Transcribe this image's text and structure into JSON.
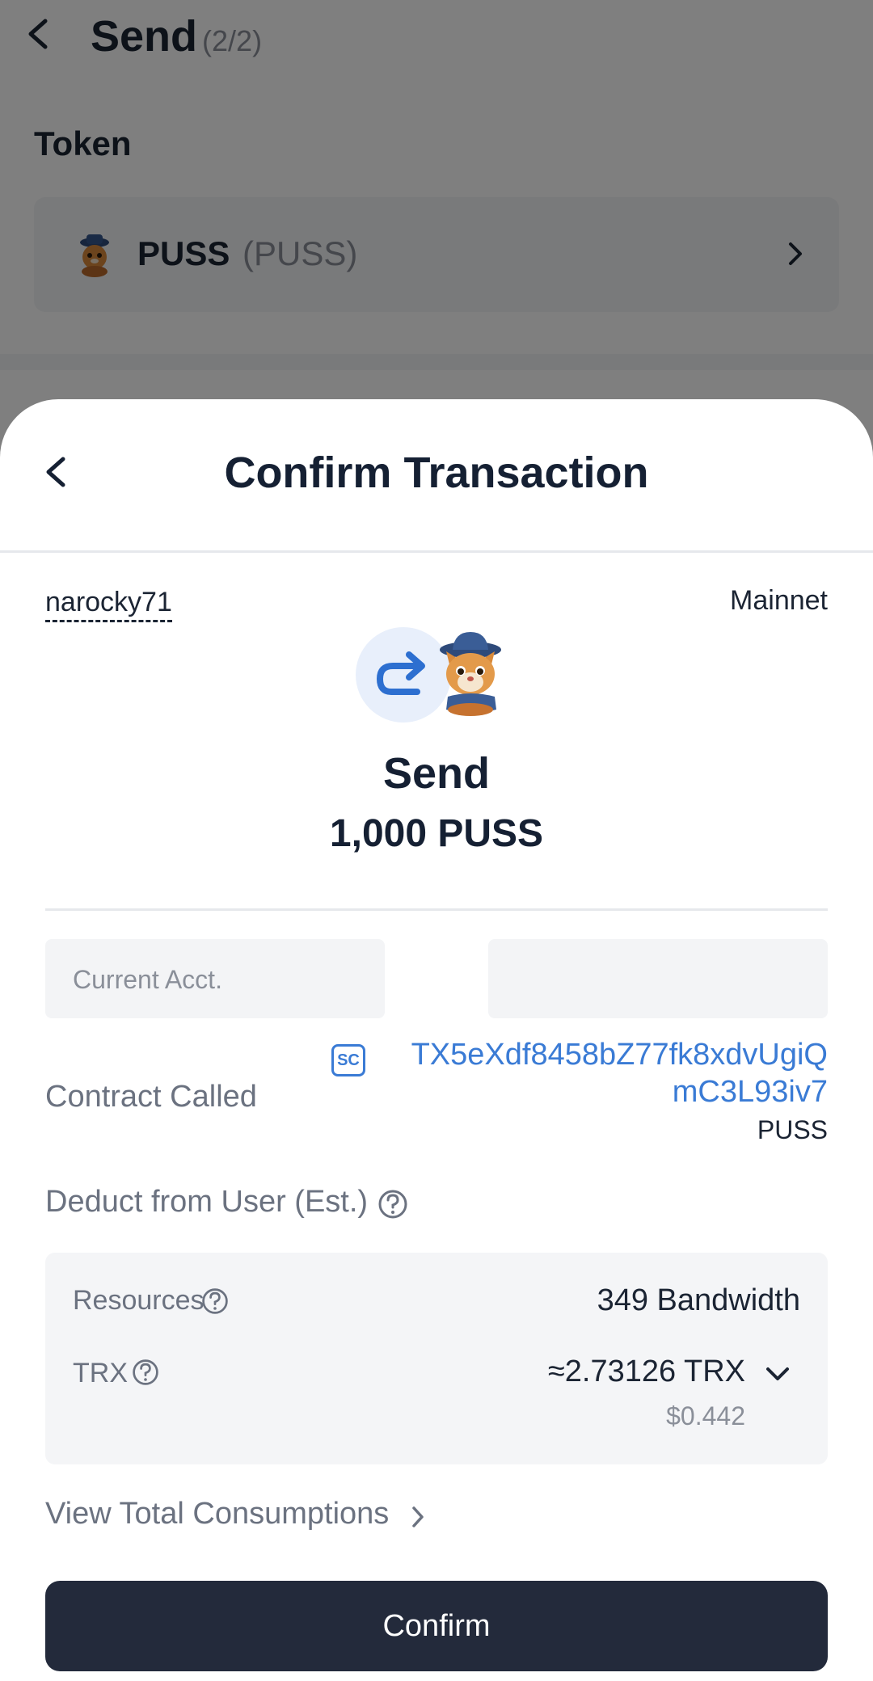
{
  "background": {
    "title": "Send",
    "step": "(2/2)",
    "token_label": "Token",
    "token_name": "PUSS",
    "token_symbol": "(PUSS)"
  },
  "sheet": {
    "title": "Confirm Transaction",
    "account_name": "narocky71",
    "network": "Mainnet",
    "action": "Send",
    "amount": "1,000 PUSS",
    "current_account_label": "Current Acct.",
    "contract_label": "Contract Called",
    "contract_badge": "SC",
    "contract_address_line1": "TX5eXdf8458bZ77fk8xdvUgiQ",
    "contract_address_line2": "mC3L93iv7",
    "contract_token": "PUSS",
    "deduct_label": "Deduct from User (Est.)",
    "fees": {
      "resources_label": "Resources",
      "resources_value": "349 Bandwidth",
      "trx_label": "TRX",
      "trx_value": "≈2.73126 TRX",
      "trx_usd": "$0.442"
    },
    "view_total": "View Total Consumptions",
    "confirm_button": "Confirm"
  },
  "colors": {
    "accent": "#3a7bd5",
    "button": "#232a3b",
    "overlay": "rgba(0,0,0,0.5)"
  },
  "icons": [
    "back-arrow-icon",
    "chevron-right-icon",
    "send-redirect-icon",
    "cat-token-icon",
    "help-circle-icon",
    "chevron-down-icon",
    "smart-contract-icon"
  ]
}
